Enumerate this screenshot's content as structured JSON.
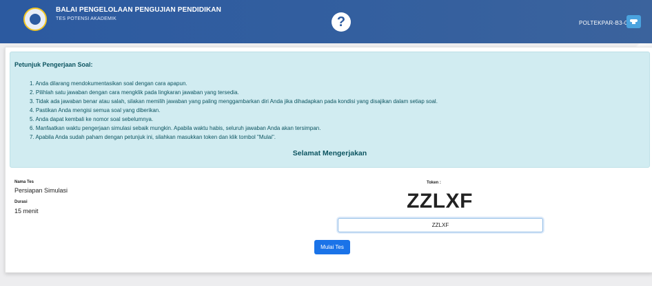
{
  "header": {
    "org_title": "BALAI PENGELOLAAN PENGUJIAN PENDIDIKAN",
    "org_subtitle": "TES POTENSI AKADEMIK",
    "help_symbol": "?",
    "user": "POLTEKPAR-B3-02",
    "logo_icon": "tut-wuri-handayani-logo",
    "user_icon": "graduation-cap-icon",
    "brand_color": "#2c5aa0"
  },
  "instructions": {
    "title": "Petunjuk Pengerjaan Soal:",
    "items": [
      "1. Anda dilarang mendokumentasikan soal dengan cara apapun.",
      "2. Pilihlah satu jawaban dengan cara mengklik pada lingkaran jawaban yang tersedia.",
      "3. Tidak ada jawaban benar atau salah, silakan memilih jawaban yang paling menggambarkan diri Anda jika dihadapkan pada kondisi yang disajikan dalam setiap soal.",
      "4. Pastikan Anda mengisi semua soal yang diberikan.",
      "5. Anda dapat kembali ke nomor soal sebelumnya.",
      "6. Manfaatkan waktu pengerjaan simulasi sebaik mungkin. Apabila waktu habis, seluruh jawaban Anda akan tersimpan.",
      "7. Apabila Anda sudah paham dengan petunjuk ini, silahkan masukkan token dan klik tombol \"Mulai\"."
    ],
    "greeting": "Selamat Mengerjakan",
    "bg_color": "#d1ecf1"
  },
  "test": {
    "name_label": "Nama Tes",
    "name_value": "Persiapan Simulasi",
    "duration_label": "Durasi",
    "duration_value": "15 menit"
  },
  "token": {
    "label": "Token :",
    "value": "ZZLXF",
    "input_value": "ZZLXF"
  },
  "start_button": {
    "label": "Mulai Tes",
    "color": "#1a73e8"
  }
}
